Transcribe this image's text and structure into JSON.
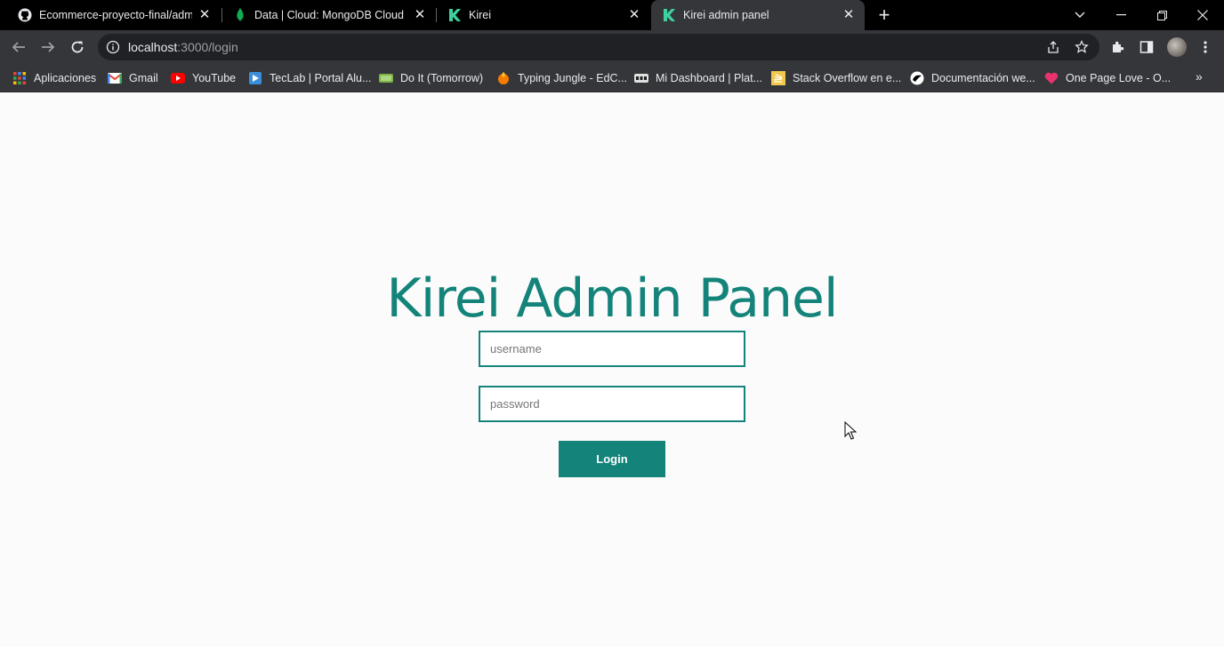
{
  "browser": {
    "tabs": [
      {
        "title": "Ecommerce-proyecto-final/admin",
        "favicon": "github-icon",
        "active": false
      },
      {
        "title": "Data | Cloud: MongoDB Cloud",
        "favicon": "mongodb-leaf-icon",
        "active": false
      },
      {
        "title": "Kirei",
        "favicon": "kirei-k-icon",
        "active": false
      },
      {
        "title": "Kirei admin panel",
        "favicon": "kirei-k-icon",
        "active": true
      }
    ],
    "address_bar": {
      "host": "localhost",
      "path": ":3000/login"
    },
    "bookmarks": [
      {
        "label": "Aplicaciones",
        "icon": "apps-grid-icon"
      },
      {
        "label": "Gmail",
        "icon": "gmail-icon"
      },
      {
        "label": "YouTube",
        "icon": "youtube-icon"
      },
      {
        "label": "TecLab | Portal Alu...",
        "icon": "teclab-icon"
      },
      {
        "label": "Do It (Tomorrow)",
        "icon": "doit-icon"
      },
      {
        "label": "Typing Jungle - EdC...",
        "icon": "typing-jungle-icon"
      },
      {
        "label": "Mi Dashboard | Plat...",
        "icon": "dashboard-icon"
      },
      {
        "label": "Stack Overflow en e...",
        "icon": "stackoverflow-icon"
      },
      {
        "label": "Documentación we...",
        "icon": "documentation-icon"
      },
      {
        "label": "One Page Love - O...",
        "icon": "heart-icon"
      }
    ]
  },
  "login": {
    "title": "Kirei Admin Panel",
    "username_placeholder": "username",
    "password_placeholder": "password",
    "button_label": "Login"
  },
  "colors": {
    "accent": "#14847a",
    "page_background": "#fbfbfb",
    "browser_chrome": "#35363a",
    "tabstrip": "#000000"
  }
}
